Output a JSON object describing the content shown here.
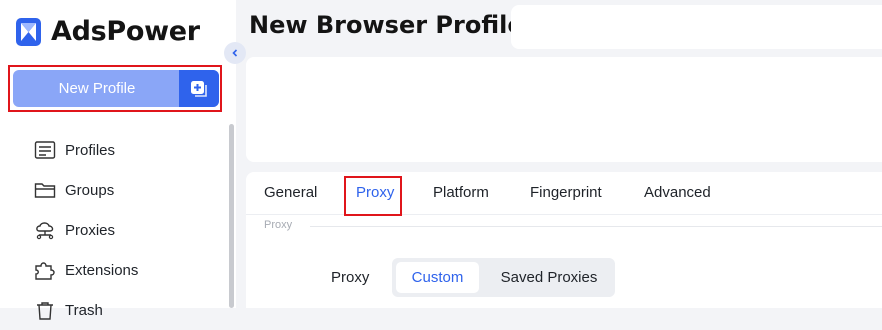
{
  "app": {
    "brand": "AdsPower"
  },
  "sidebar": {
    "new_profile_label": "New Profile",
    "items": [
      {
        "label": "Profiles",
        "icon": "profiles-icon"
      },
      {
        "label": "Groups",
        "icon": "folder-icon"
      },
      {
        "label": "Proxies",
        "icon": "proxies-icon"
      },
      {
        "label": "Extensions",
        "icon": "puzzle-icon"
      },
      {
        "label": "Trash",
        "icon": "trash-icon"
      }
    ]
  },
  "header": {
    "title": "New Browser Profile"
  },
  "tabs": {
    "items": [
      "General",
      "Proxy",
      "Platform",
      "Fingerprint",
      "Advanced"
    ],
    "active": "Proxy"
  },
  "proxy_section": {
    "section_label": "Proxy",
    "field_label": "Proxy",
    "options": [
      "Custom",
      "Saved Proxies"
    ],
    "selected": "Custom"
  },
  "colors": {
    "accent": "#2f63ec",
    "button_light": "#8aa6f7",
    "highlight_box": "#e0151b"
  }
}
